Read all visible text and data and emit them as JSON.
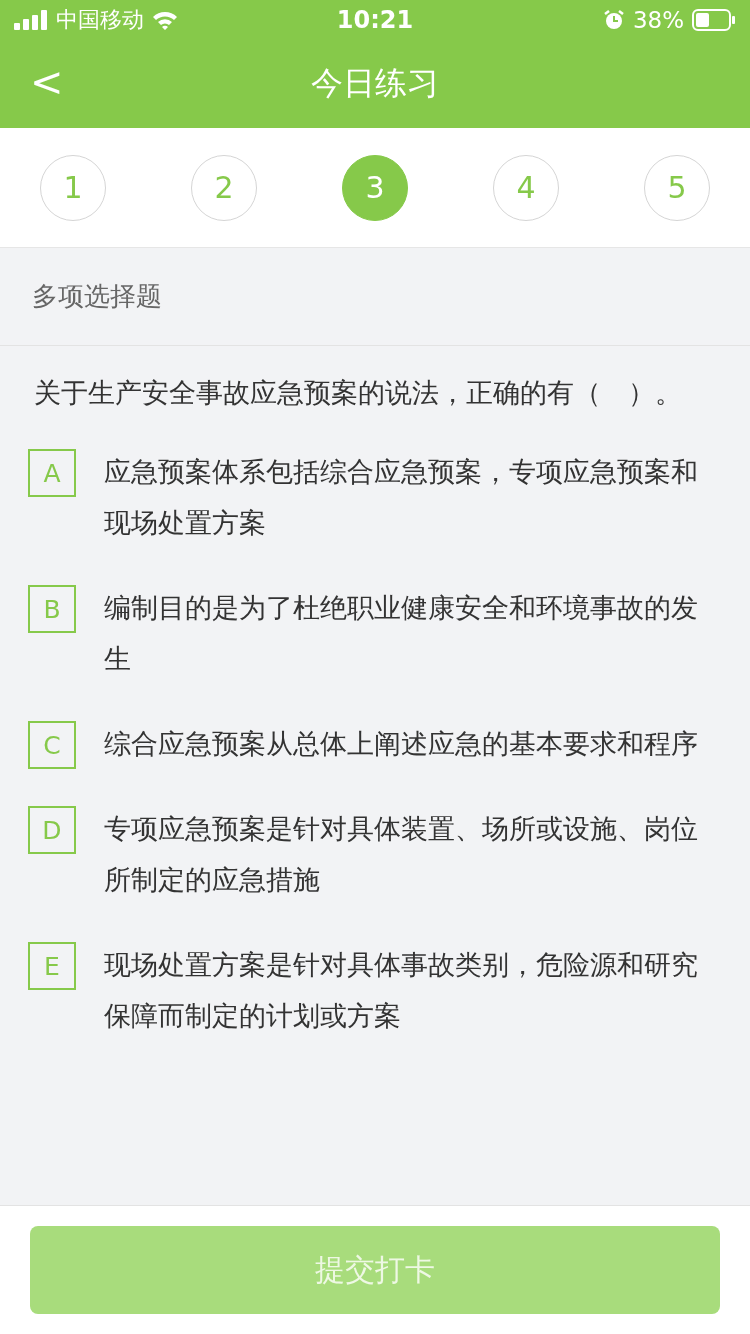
{
  "status_bar": {
    "carrier": "中国移动",
    "time": "10:21",
    "battery": "38%"
  },
  "nav": {
    "back": "<",
    "title": "今日练习"
  },
  "steps": [
    {
      "label": "1",
      "selected": false
    },
    {
      "label": "2",
      "selected": false
    },
    {
      "label": "3",
      "selected": true
    },
    {
      "label": "4",
      "selected": false
    },
    {
      "label": "5",
      "selected": false
    }
  ],
  "section": "多项选择题",
  "question": "关于生产安全事故应急预案的说法，正确的有（　）。",
  "options": [
    {
      "letter": "A",
      "text": "应急预案体系包括综合应急预案，专项应急预案和现场处置方案",
      "selected": false
    },
    {
      "letter": "B",
      "text": "编制目的是为了杜绝职业健康安全和环境事故的发生",
      "selected": false
    },
    {
      "letter": "C",
      "text": "综合应急预案从总体上阐述应急的基本要求和程序",
      "selected": false
    },
    {
      "letter": "D",
      "text": "专项应急预案是针对具体装置、场所或设施、岗位所制定的应急措施",
      "selected": false
    },
    {
      "letter": "E",
      "text": "现场处置方案是针对具体事故类别，危险源和研究保障而制定的计划或方案",
      "selected": false
    }
  ],
  "submit": {
    "label": "提交打卡",
    "disabled": true
  }
}
